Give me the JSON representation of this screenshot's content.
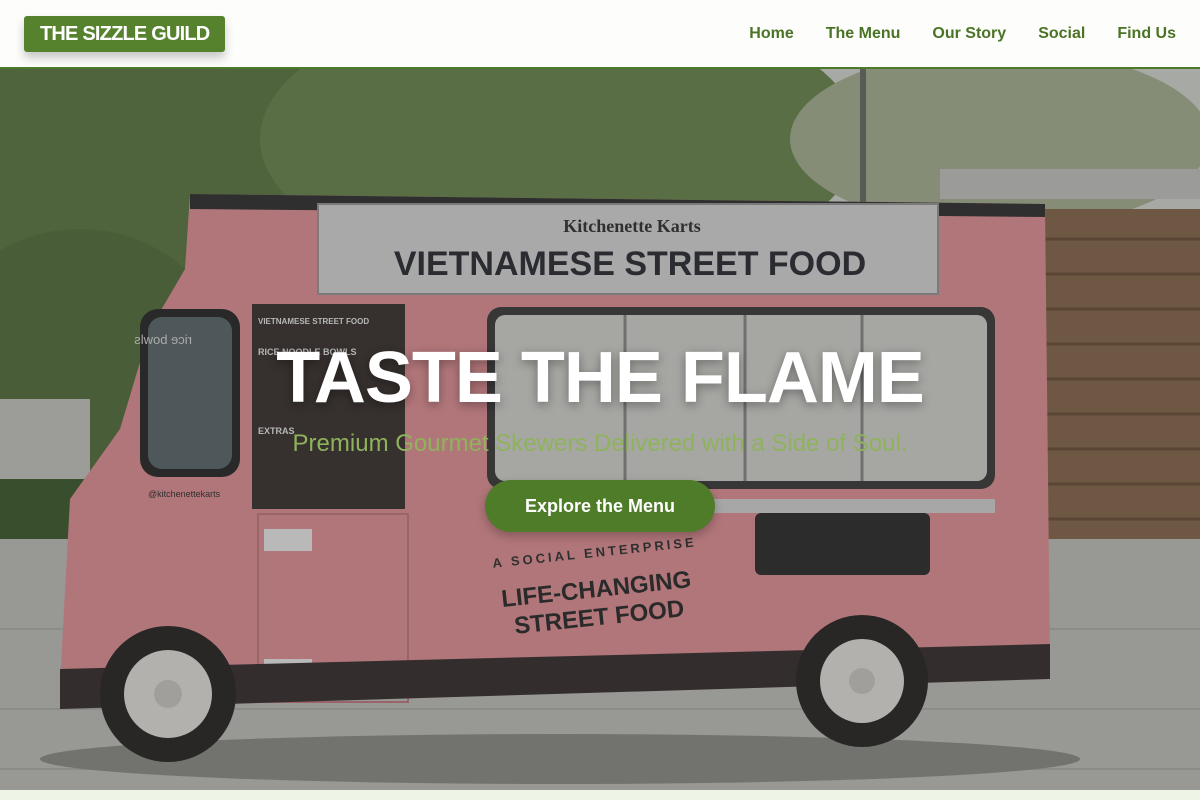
{
  "header": {
    "logo": "THE SIZZLE GUILD",
    "nav": [
      {
        "label": "Home"
      },
      {
        "label": "The Menu"
      },
      {
        "label": "Our Story"
      },
      {
        "label": "Social"
      },
      {
        "label": "Find Us"
      }
    ]
  },
  "hero": {
    "title": "TASTE THE FLAME",
    "subtitle": "Premium Gourmet Skewers Delivered with a Side of Soul.",
    "cta_label": "Explore the Menu"
  },
  "truck": {
    "brand": "Kitchenette Karts",
    "sign": "VIETNAMESE STREET FOOD",
    "menu_board": {
      "heading": "VIETNAMESE STREET FOOD",
      "section1": "RICE NOODLE BOWLS",
      "section2": "EXTRAS"
    },
    "window_sticker": "rice bowls",
    "handle": "@kitchenettekarts",
    "slogan_top": "A SOCIAL ENTERPRISE",
    "slogan_line1": "LIFE-CHANGING",
    "slogan_line2": "STREET FOOD"
  },
  "colors": {
    "brand_green": "#56822e",
    "nav_green": "#4a7326",
    "subtitle_green": "#8fb35c",
    "truck_pink": "#e6959a"
  }
}
